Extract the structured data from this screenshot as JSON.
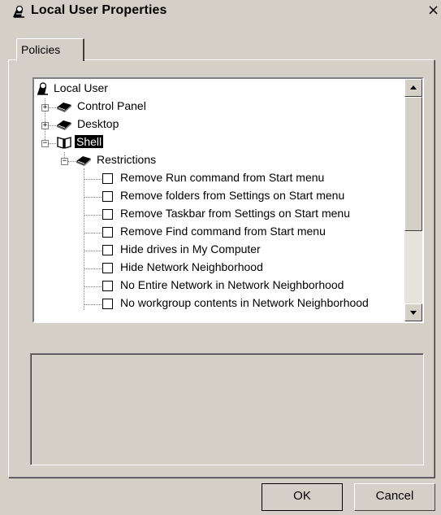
{
  "window": {
    "title": "Local User Properties",
    "close_glyph": "×",
    "title_icon": "local-user-icon"
  },
  "tabs": [
    {
      "label": "Policies",
      "active": true
    }
  ],
  "tree": {
    "root": {
      "label": "Local User",
      "icon": "local-user-icon"
    },
    "categories": [
      {
        "label": "Control Panel",
        "expander": "+",
        "icon": "book-closed-icon"
      },
      {
        "label": "Desktop",
        "expander": "+",
        "icon": "book-closed-icon"
      },
      {
        "label": "Shell",
        "expander": "−",
        "icon": "book-open-icon",
        "selected": true
      }
    ],
    "subcategory": {
      "label": "Restrictions",
      "expander": "−",
      "icon": "book-closed-icon"
    },
    "policies": [
      {
        "label": "Remove Run command from Start menu",
        "checked": false
      },
      {
        "label": "Remove folders from Settings on Start menu",
        "checked": false
      },
      {
        "label": "Remove Taskbar from Settings on Start menu",
        "checked": false
      },
      {
        "label": "Remove Find command from Start menu",
        "checked": false
      },
      {
        "label": "Hide drives in My Computer",
        "checked": false
      },
      {
        "label": "Hide Network Neighborhood",
        "checked": false
      },
      {
        "label": "No Entire Network in Network Neighborhood",
        "checked": false
      },
      {
        "label": "No workgroup contents in Network Neighborhood",
        "checked": false
      }
    ]
  },
  "buttons": {
    "ok": "OK",
    "cancel": "Cancel"
  },
  "colors": {
    "face": "#d4d0c8",
    "selection": "#000000"
  }
}
